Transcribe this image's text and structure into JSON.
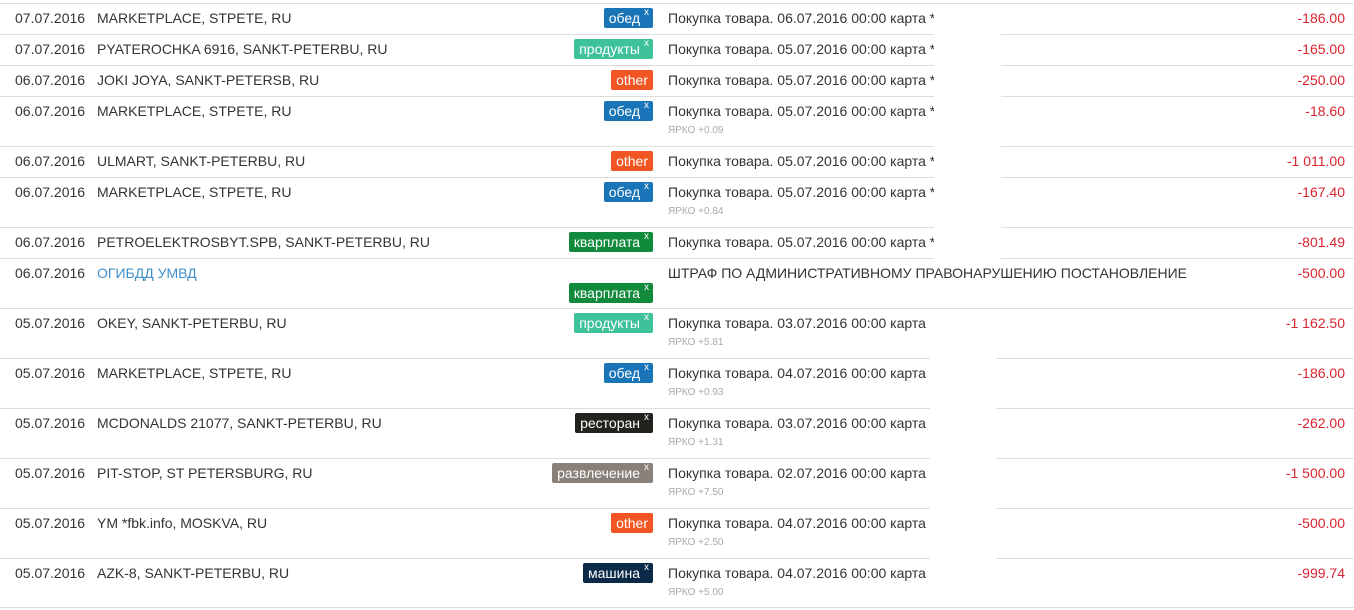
{
  "transactions": [
    {
      "date": "07.07.2016",
      "merchant": "MARKETPLACE, STPETE, RU",
      "tag": {
        "label": "обед",
        "color": "#1a75b8"
      },
      "description": "Покупка товара. 06.07.2016 00:00 карта *",
      "bonus": "",
      "amount": "-186.00"
    },
    {
      "date": "07.07.2016",
      "merchant": "PYATEROCHKA 6916, SANKT-PETERBU, RU",
      "tag": {
        "label": "продукты",
        "color": "#3ec29a"
      },
      "description": "Покупка товара. 05.07.2016 00:00 карта *",
      "bonus": "",
      "amount": "-165.00"
    },
    {
      "date": "06.07.2016",
      "merchant": "JOKI JOYA, SANKT-PETERSB, RU",
      "tag": {
        "label": "other",
        "color": "#f05522"
      },
      "description": "Покупка товара. 05.07.2016 00:00 карта *",
      "bonus": "",
      "amount": "-250.00"
    },
    {
      "date": "06.07.2016",
      "merchant": "MARKETPLACE, STPETE, RU",
      "tag": {
        "label": "обед",
        "color": "#1a75b8"
      },
      "description": "Покупка товара. 05.07.2016 00:00 карта *",
      "bonus": "ЯРКО +0.09",
      "amount": "-18.60"
    },
    {
      "date": "06.07.2016",
      "merchant": "ULMART, SANKT-PETERBU, RU",
      "tag": {
        "label": "other",
        "color": "#f05522"
      },
      "description": "Покупка товара. 05.07.2016 00:00 карта *",
      "bonus": "",
      "amount": "-1 011.00"
    },
    {
      "date": "06.07.2016",
      "merchant": "MARKETPLACE, STPETE, RU",
      "tag": {
        "label": "обед",
        "color": "#1a75b8"
      },
      "description": "Покупка товара. 05.07.2016 00:00 карта *",
      "bonus": "ЯРКО +0.84",
      "amount": "-167.40"
    },
    {
      "date": "06.07.2016",
      "merchant": "PETROELEKTROSBYT.SPB, SANKT-PETERBU, RU",
      "tag": {
        "label": "кварплата",
        "color": "#128a3c"
      },
      "description": "Покупка товара. 05.07.2016 00:00 карта *",
      "bonus": "",
      "amount": "-801.49"
    },
    {
      "date": "06.07.2016",
      "merchant": "ОГИБДД УМВД",
      "tag": {
        "label": "кварплата",
        "color": "#128a3c"
      },
      "description": "ШТРАФ ПО АДМИНИСТРАТИВНОМУ ПРАВОНАРУШЕНИЮ ПОСТАНОВЛЕНИЕ",
      "bonus": "",
      "amount": "-500.00"
    },
    {
      "date": "05.07.2016",
      "merchant": "OKEY, SANKT-PETERBU, RU",
      "tag": {
        "label": "продукты",
        "color": "#3ec29a"
      },
      "description": "Покупка товара. 03.07.2016 00:00 карта",
      "bonus": "ЯРКО +5.81",
      "amount": "-1 162.50"
    },
    {
      "date": "05.07.2016",
      "merchant": "MARKETPLACE, STPETE, RU",
      "tag": {
        "label": "обед",
        "color": "#1a75b8"
      },
      "description": "Покупка товара. 04.07.2016 00:00 карта",
      "bonus": "ЯРКО +0.93",
      "amount": "-186.00"
    },
    {
      "date": "05.07.2016",
      "merchant": "MCDONALDS 21077, SANKT-PETERBU, RU",
      "tag": {
        "label": "ресторан",
        "color": "#22221f"
      },
      "description": "Покупка товара. 03.07.2016 00:00 карта",
      "bonus": "ЯРКО +1.31",
      "amount": "-262.00"
    },
    {
      "date": "05.07.2016",
      "merchant": "PIT-STOP, ST PETERSBURG, RU",
      "tag": {
        "label": "развлечение",
        "color": "#888079"
      },
      "description": "Покупка товара. 02.07.2016 00:00 карта",
      "bonus": "ЯРКО +7.50",
      "amount": "-1 500.00"
    },
    {
      "date": "05.07.2016",
      "merchant": "YM *fbk.info, MOSKVA, RU",
      "tag": {
        "label": "other",
        "color": "#f05522"
      },
      "description": "Покупка товара. 04.07.2016 00:00 карта",
      "bonus": "ЯРКО +2.50",
      "amount": "-500.00"
    },
    {
      "date": "05.07.2016",
      "merchant": "AZK-8, SANKT-PETERBU, RU",
      "tag": {
        "label": "машина",
        "color": "#0a2a48"
      },
      "description": "Покупка товара. 04.07.2016 00:00 карта",
      "bonus": "ЯРКО +5.00",
      "amount": "-999.74"
    }
  ]
}
